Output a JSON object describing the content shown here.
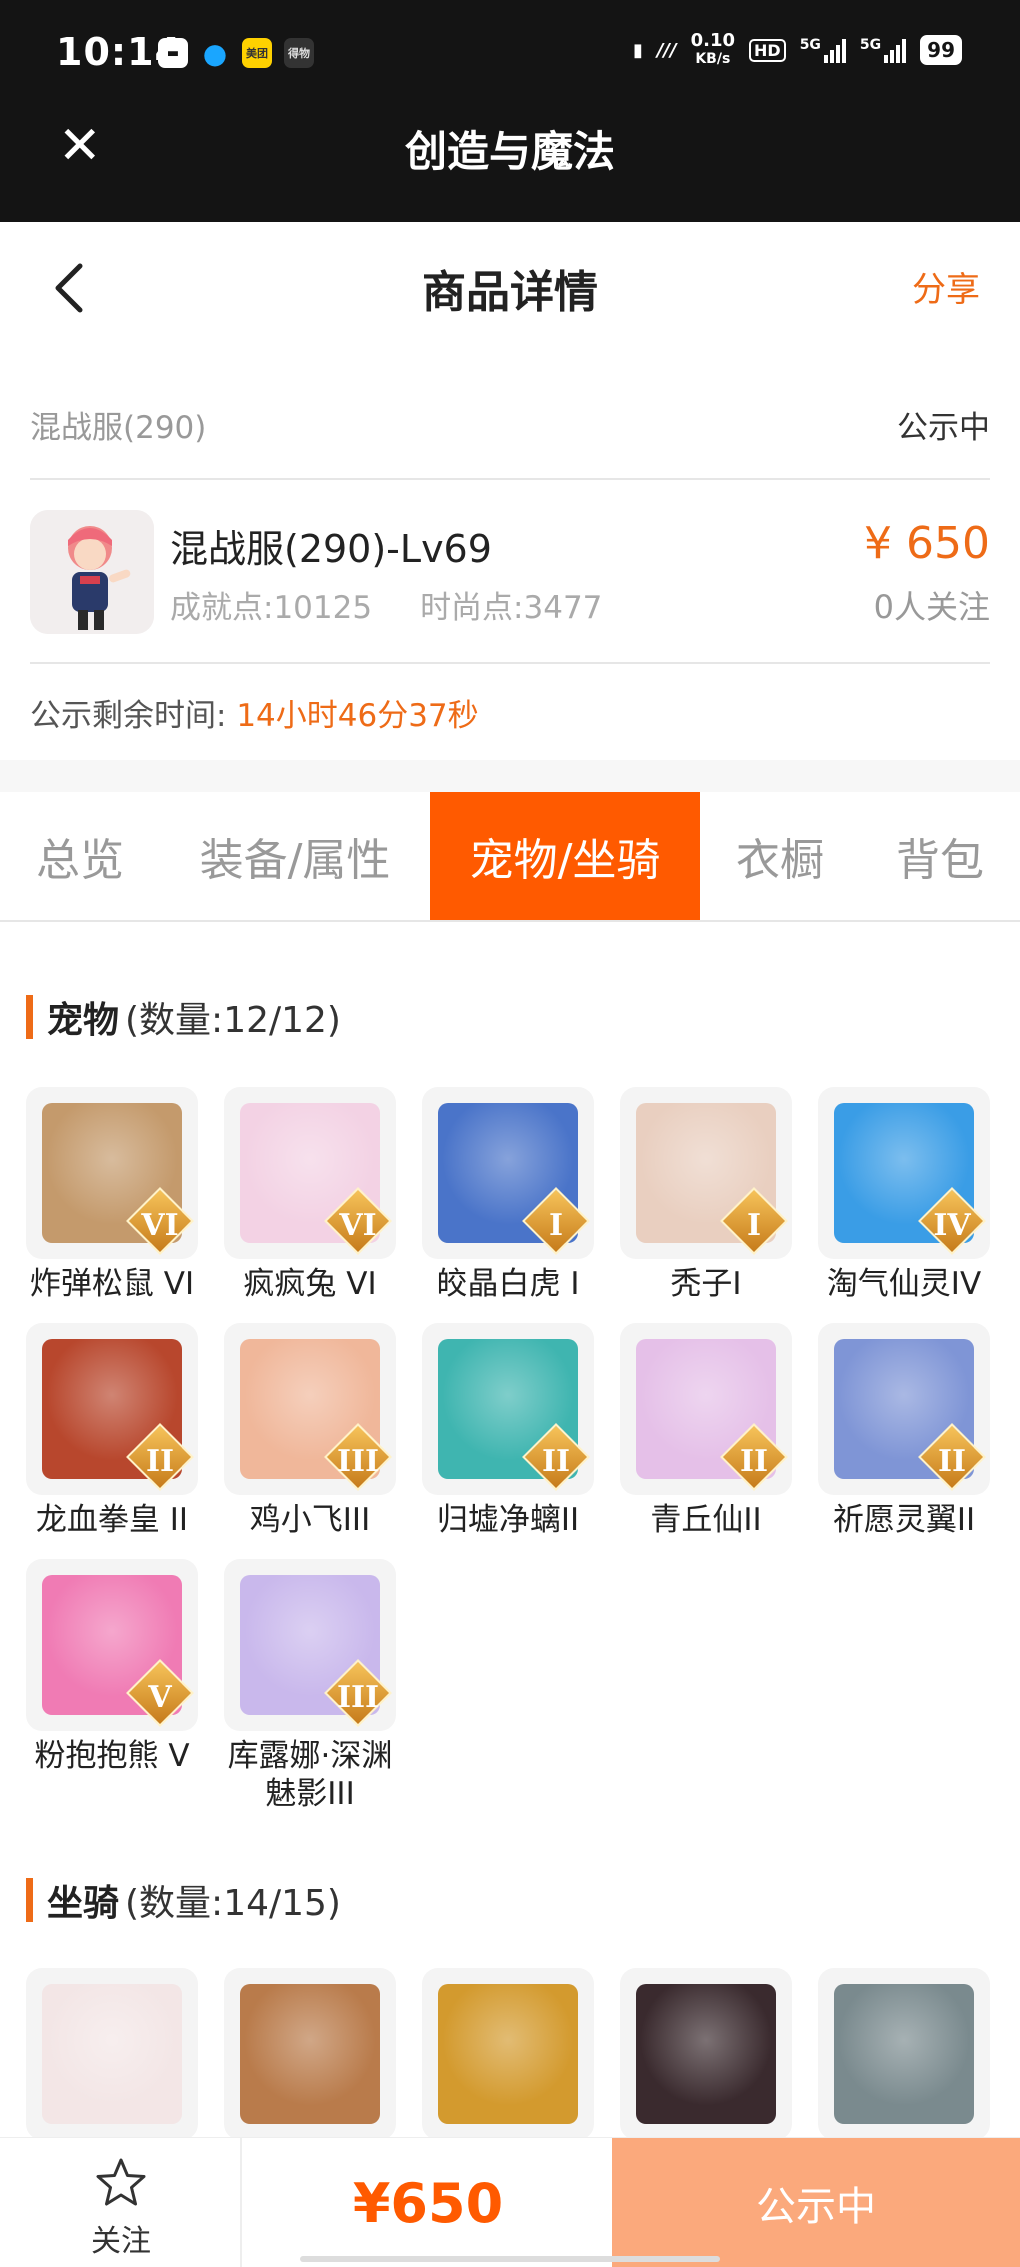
{
  "status": {
    "time": "10:14",
    "app_badge_1": "美团",
    "app_badge_2": "得物",
    "net_speed": "0.10",
    "net_unit": "KB/s",
    "hd": "HD",
    "net1": "5G",
    "net2": "5G",
    "battery": "99"
  },
  "window": {
    "title": "创造与魔法",
    "close_icon": "close-icon"
  },
  "nav": {
    "title": "商品详情",
    "share": "分享",
    "back_icon": "chevron-left-icon"
  },
  "info": {
    "server": "混战服(290)",
    "state": "公示中",
    "product_name": "混战服(290)-Lv69",
    "achievement": "成就点:10125",
    "fashion": "时尚点:3477",
    "price": "¥ 650",
    "followers": "0人关注",
    "remain_label": "公示剩余时间:",
    "remain_value": "14小时46分37秒"
  },
  "tabs": [
    "总览",
    "装备/属性",
    "宠物/坐骑",
    "衣橱",
    "背包"
  ],
  "active_tab": 2,
  "pets": {
    "title": "宠物",
    "count": "(数量:12/12)",
    "items": [
      {
        "name": "炸弹松鼠 VI",
        "level": "VI",
        "color": "#c49a6c"
      },
      {
        "name": "疯疯兔 VI",
        "level": "VI",
        "color": "#f3d2e4"
      },
      {
        "name": "皎晶白虎 I",
        "level": "I",
        "color": "#4a74c9"
      },
      {
        "name": "秃子I",
        "level": "I",
        "color": "#e9cfc0"
      },
      {
        "name": "淘气仙灵IV",
        "level": "IV",
        "color": "#3a9de6"
      },
      {
        "name": "龙血拳皇 II",
        "level": "II",
        "color": "#b8472d"
      },
      {
        "name": "鸡小飞III",
        "level": "III",
        "color": "#f0b79a"
      },
      {
        "name": "归墟净螭II",
        "level": "II",
        "color": "#3fb5b0"
      },
      {
        "name": "青丘仙II",
        "level": "II",
        "color": "#e5c0e8"
      },
      {
        "name": "祈愿灵翼II",
        "level": "II",
        "color": "#7f95d6"
      },
      {
        "name": "粉抱抱熊 V",
        "level": "V",
        "color": "#f07bb4"
      },
      {
        "name": "库露娜·深渊魅影III",
        "level": "III",
        "color": "#c9b8ec"
      }
    ]
  },
  "mounts": {
    "title": "坐骑",
    "count": "(数量:14/15)",
    "items": [
      {
        "color": "#f3e6e6"
      },
      {
        "color": "#b97b4b"
      },
      {
        "color": "#d39a2e"
      },
      {
        "color": "#3a2a2e"
      },
      {
        "color": "#7a8a8e"
      }
    ]
  },
  "bottom": {
    "follow": "关注",
    "price": "¥650",
    "button": "公示中",
    "star_icon": "star-icon"
  },
  "colors": {
    "accent": "#ee6b17",
    "tab_active": "#ff5a00",
    "button": "#fba97c"
  }
}
